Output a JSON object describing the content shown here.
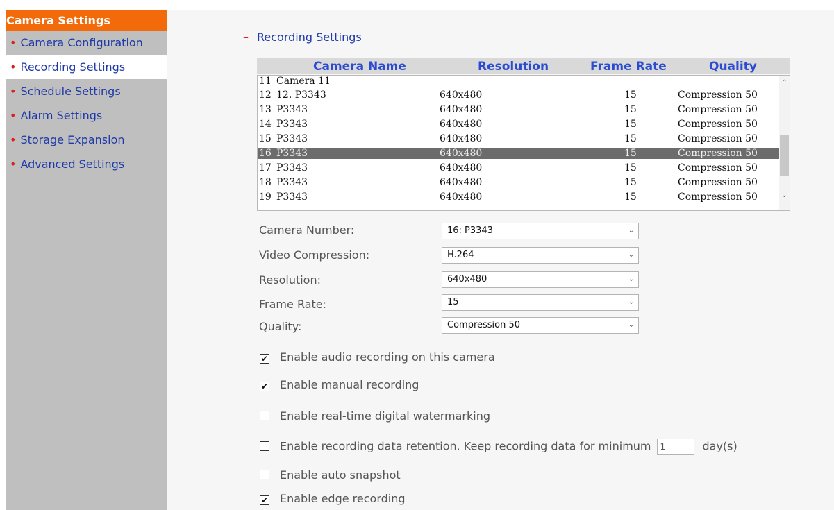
{
  "sidebar": {
    "title": "Camera Settings",
    "items": [
      {
        "label": "Camera Configuration",
        "active": false
      },
      {
        "label": "Recording Settings",
        "active": true
      },
      {
        "label": "Schedule Settings",
        "active": false
      },
      {
        "label": "Alarm Settings",
        "active": false
      },
      {
        "label": "Storage Expansion",
        "active": false
      },
      {
        "label": "Advanced Settings",
        "active": false
      }
    ]
  },
  "section": {
    "toggle": "–",
    "title": "Recording Settings"
  },
  "camera_table": {
    "headers": [
      "Camera Name",
      "Resolution",
      "Frame Rate",
      "Quality"
    ],
    "rows": [
      {
        "num": "11",
        "name": "Camera 11",
        "resolution": "",
        "frame_rate": "",
        "quality": "",
        "selected": false
      },
      {
        "num": "12",
        "name": "12. P3343",
        "resolution": "640x480",
        "frame_rate": "15",
        "quality": "Compression 50",
        "selected": false
      },
      {
        "num": "13",
        "name": "P3343",
        "resolution": "640x480",
        "frame_rate": "15",
        "quality": "Compression 50",
        "selected": false
      },
      {
        "num": "14",
        "name": "P3343",
        "resolution": "640x480",
        "frame_rate": "15",
        "quality": "Compression 50",
        "selected": false
      },
      {
        "num": "15",
        "name": "P3343",
        "resolution": "640x480",
        "frame_rate": "15",
        "quality": "Compression 50",
        "selected": false
      },
      {
        "num": "16",
        "name": "P3343",
        "resolution": "640x480",
        "frame_rate": "15",
        "quality": "Compression 50",
        "selected": true
      },
      {
        "num": "17",
        "name": "P3343",
        "resolution": "640x480",
        "frame_rate": "15",
        "quality": "Compression 50",
        "selected": false
      },
      {
        "num": "18",
        "name": "P3343",
        "resolution": "640x480",
        "frame_rate": "15",
        "quality": "Compression 50",
        "selected": false
      },
      {
        "num": "19",
        "name": "P3343",
        "resolution": "640x480",
        "frame_rate": "15",
        "quality": "Compression 50",
        "selected": false
      }
    ]
  },
  "form": {
    "camera_number": {
      "label": "Camera Number:",
      "value": "16: P3343"
    },
    "video_compression": {
      "label": "Video Compression:",
      "value": "H.264"
    },
    "resolution": {
      "label": "Resolution:",
      "value": "640x480"
    },
    "frame_rate": {
      "label": "Frame Rate:",
      "value": "15"
    },
    "quality": {
      "label": "Quality:",
      "value": "Compression 50"
    }
  },
  "options": {
    "audio": {
      "label": "Enable audio recording on this camera",
      "checked": true
    },
    "manual": {
      "label": "Enable manual recording",
      "checked": true
    },
    "watermark": {
      "label": "Enable real-time digital watermarking",
      "checked": false
    },
    "retention": {
      "label": "Enable recording data retention. Keep recording data for minimum",
      "checked": false,
      "days_value": "1",
      "days_suffix": "day(s)"
    },
    "snapshot": {
      "label": "Enable auto snapshot",
      "checked": false
    },
    "edge": {
      "label": "Enable edge recording",
      "checked": true
    }
  },
  "colors": {
    "accent": "#f26a0a",
    "link": "#1f3aa8",
    "bullet": "#d82020",
    "header_text": "#2b4cd2",
    "selected_row": "#6c6c6c"
  }
}
